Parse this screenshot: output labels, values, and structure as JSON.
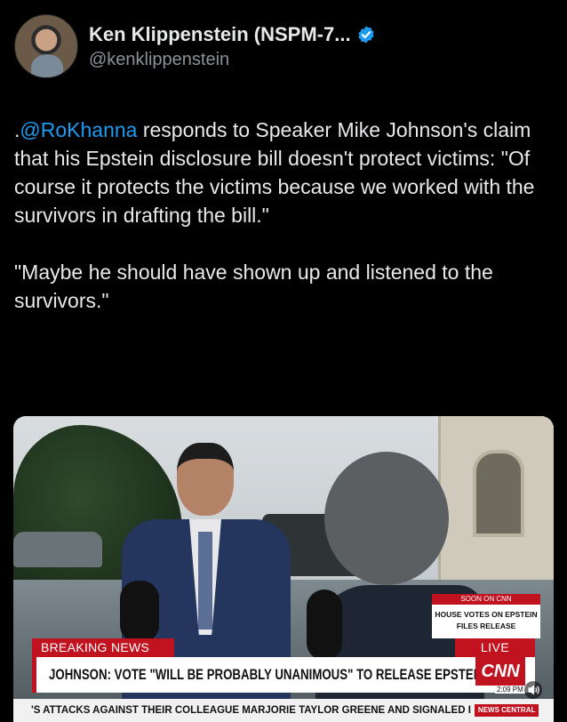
{
  "author": {
    "display_name": "Ken Klippenstein (NSPM-7...",
    "handle": "@kenklippenstein"
  },
  "tweet": {
    "prefix": ".",
    "mention": "@RoKhanna",
    "paragraph1_rest": " responds to Speaker Mike Johnson's claim that his Epstein disclosure bill doesn't protect victims: \"Of course it protects the victims because we worked with the survivors in drafting the bill.\"",
    "paragraph2": "\"Maybe he should have shown up and listened to the survivors.\""
  },
  "video": {
    "soon_label": "SOON ON CNN",
    "soon_text": "HOUSE VOTES ON EPSTEIN FILES RELEASE",
    "breaking_label": "BREAKING NEWS",
    "live_label": "LIVE",
    "headline": "JOHNSON: VOTE \"WILL BE PROBABLY UNANIMOUS\" TO RELEASE EPSTEIN FILES",
    "logo_text": "CNN",
    "time": "2:09 PM",
    "ticker": "'S ATTACKS AGAINST THEIR COLLEAGUE MARJORIE TAYLOR GREENE AND SIGNALED I",
    "ticker_tag": "NEWS CENTRAL"
  },
  "colors": {
    "mention": "#1d9bf0",
    "verified": "#1d9bf0",
    "cnn_red": "#c1121f"
  },
  "icons": [
    "verified-badge-icon",
    "sound-icon"
  ]
}
